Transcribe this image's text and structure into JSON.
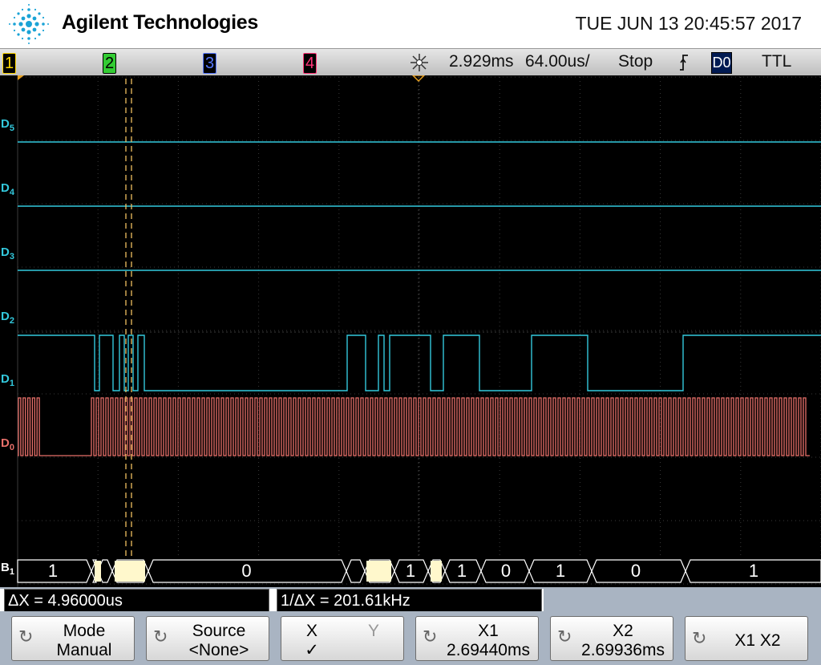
{
  "header": {
    "brand": "Agilent Technologies",
    "datetime": "TUE JUN 13 20:45:57 2017"
  },
  "status": {
    "ch1": "1",
    "ch2": "2",
    "ch3": "3",
    "ch4": "4",
    "delay": "2.929ms",
    "timebase": "64.00us/",
    "run_state": "Stop",
    "trigger_source": "D0",
    "trigger_level": "TTL",
    "colors": {
      "ch1": "#ffd700",
      "ch2": "#33cc33",
      "ch3": "#3355ff",
      "ch4": "#ff3377"
    }
  },
  "channels": {
    "d5": "D5",
    "d4": "D4",
    "d3": "D3",
    "d2": "D2",
    "d1": "D1",
    "d0": "D0",
    "b1": "B1",
    "colors": {
      "digital": "#33c9dd",
      "d0": "#e8706a",
      "bus": "#ffffff"
    }
  },
  "bus_values": [
    "1",
    "0",
    "1",
    "1",
    "0",
    "1",
    "0",
    "1"
  ],
  "measurements": {
    "delta_x": "ΔX = 4.96000us",
    "inv_delta_x": "1/ΔX = 201.61kHz"
  },
  "softkeys": {
    "mode_label": "Mode",
    "mode_value": "Manual",
    "source_label": "Source",
    "source_value": "<None>",
    "x_label": "X",
    "y_label": "Y",
    "x_check": "✓",
    "x1_label": "X1",
    "x1_value": "2.69440ms",
    "x2_label": "X2",
    "x2_value": "2.69936ms",
    "x1x2_label": "X1 X2"
  }
}
